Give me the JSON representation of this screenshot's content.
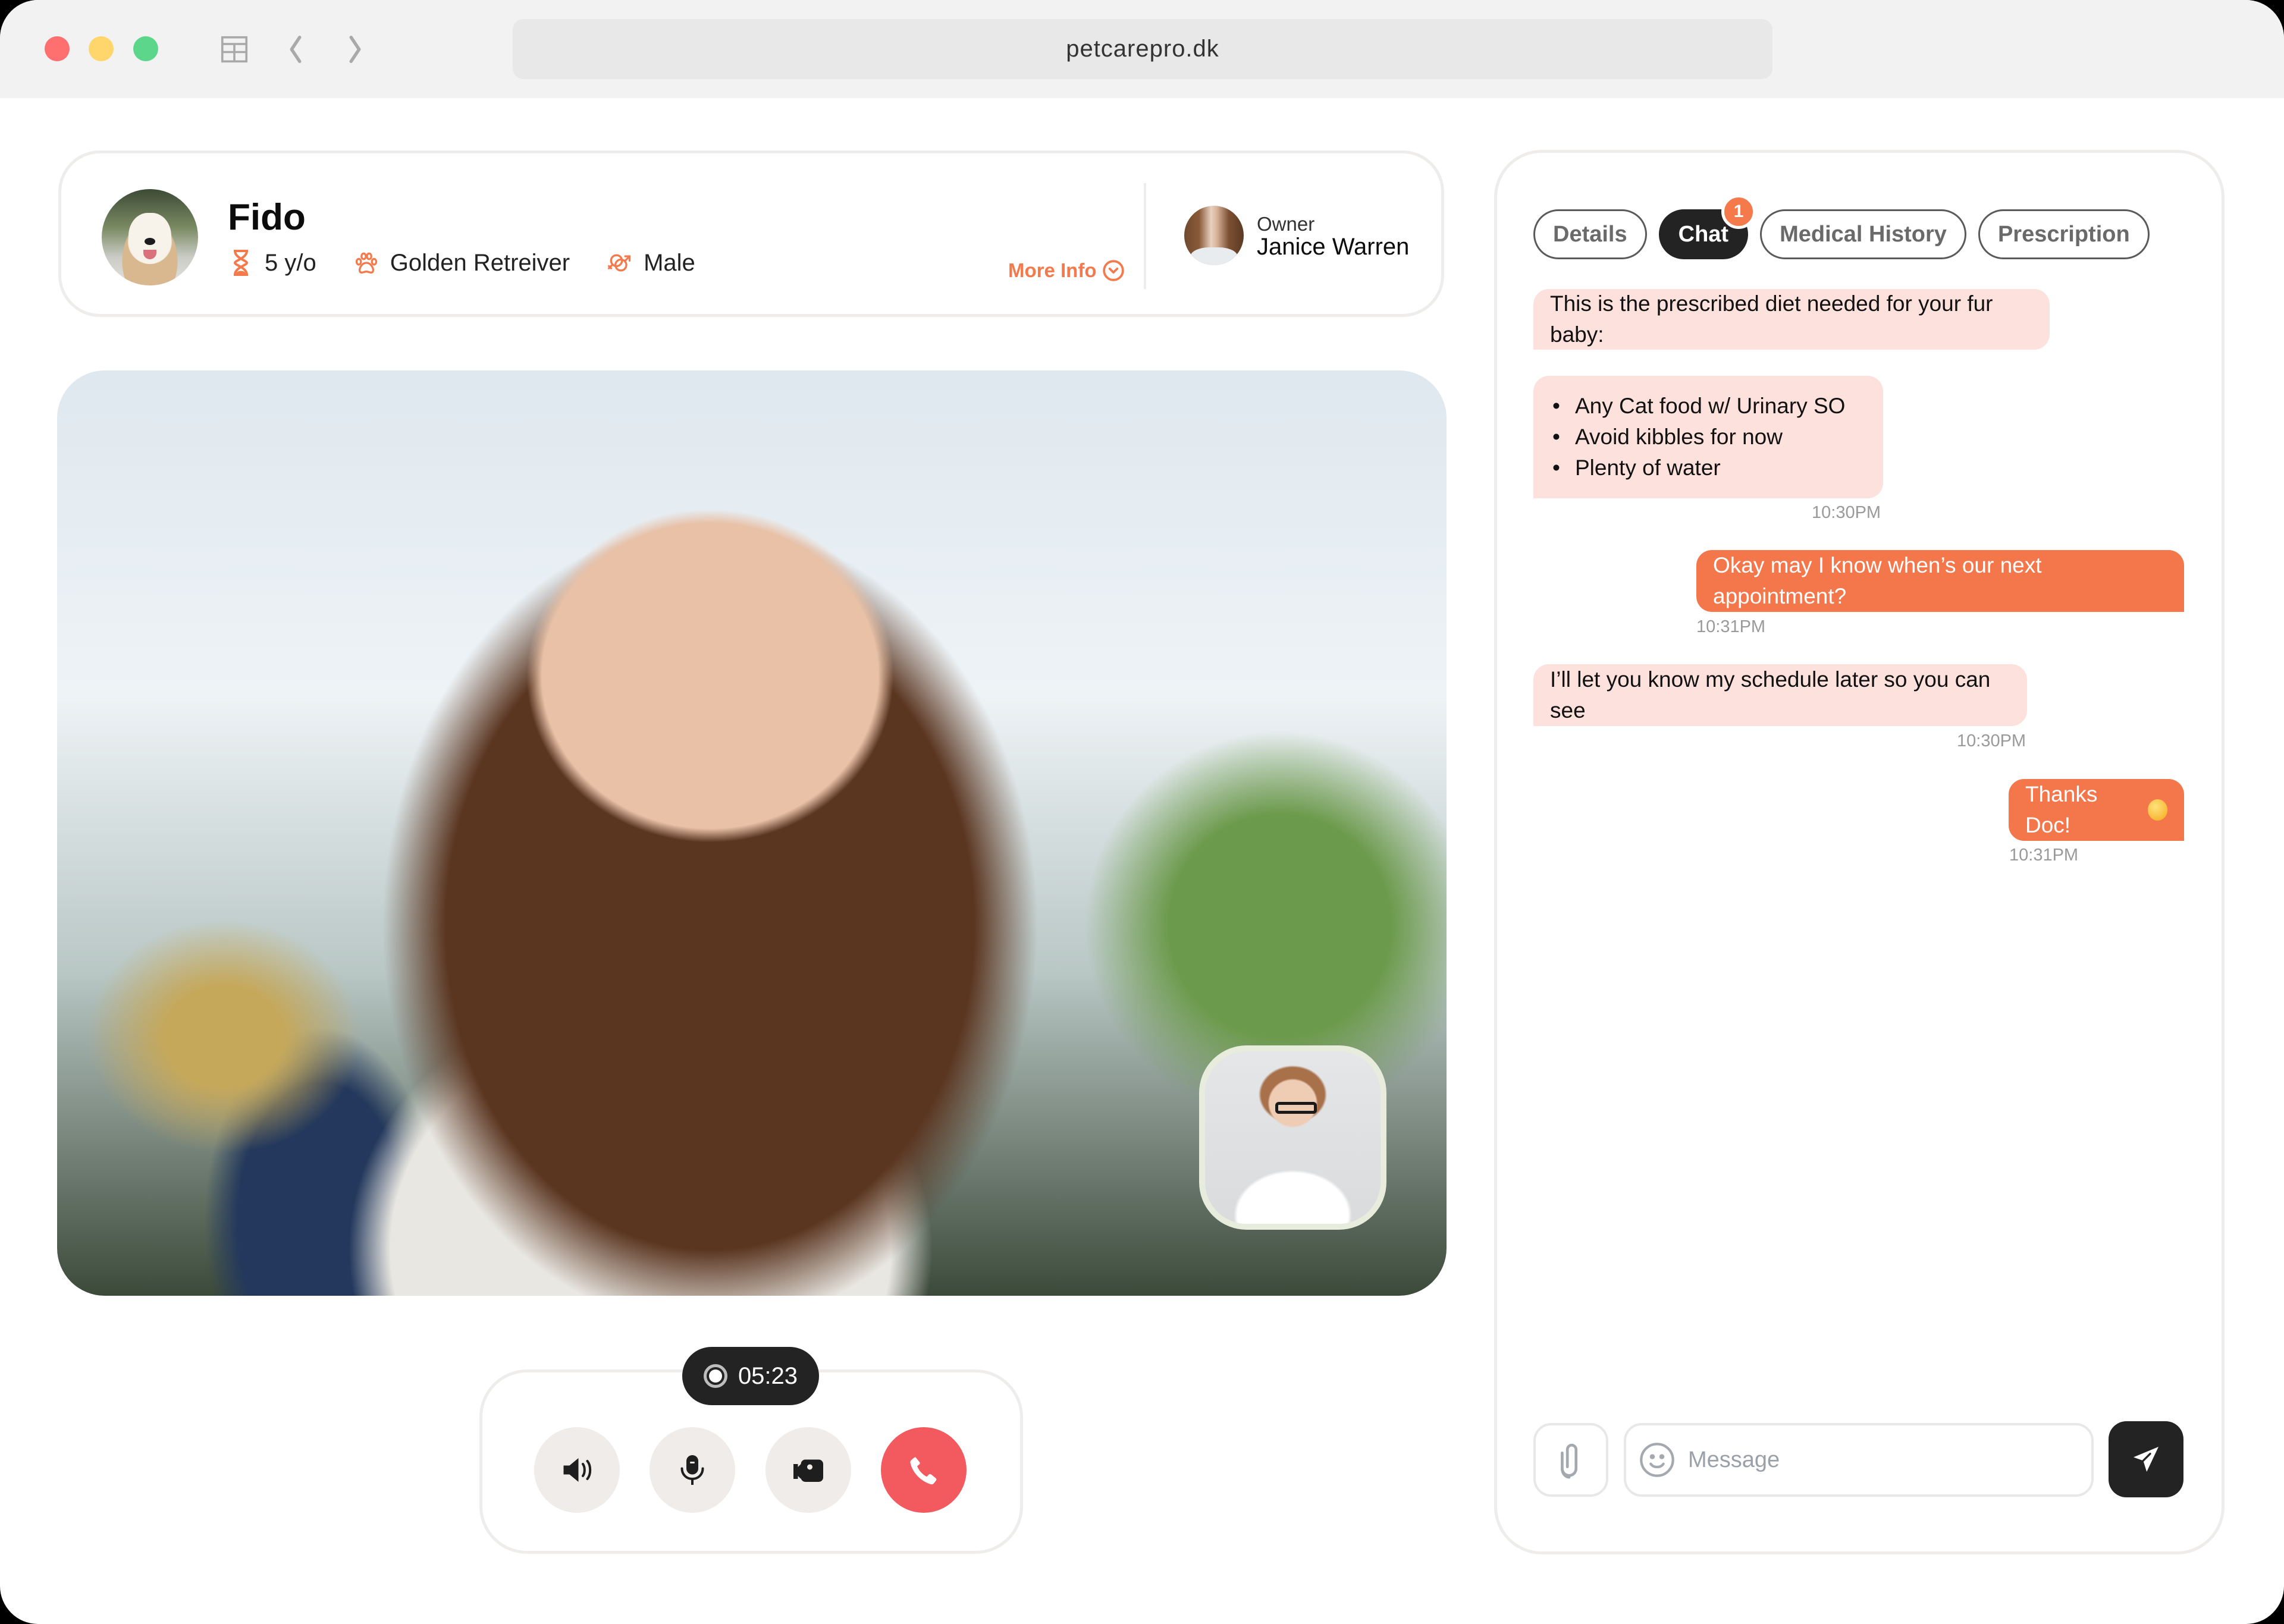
{
  "browser": {
    "url": "petcarepro.dk",
    "window_controls": [
      "close",
      "minimize",
      "maximize"
    ],
    "icons": [
      "sidebar-layout-icon",
      "back-icon",
      "forward-icon"
    ]
  },
  "pet": {
    "name": "Fido",
    "age": "5 y/o",
    "breed": "Golden Retreiver",
    "sex": "Male",
    "more_info_label": "More Info",
    "icons": {
      "age": "hourglass-icon",
      "breed": "paw-icon",
      "sex": "gender-icon",
      "more_info": "chevron-down-circle-icon"
    }
  },
  "owner": {
    "label": "Owner",
    "name": "Janice Warren"
  },
  "call": {
    "timer": "05:23",
    "controls": [
      {
        "name": "speaker",
        "icon": "speaker-icon"
      },
      {
        "name": "microphone",
        "icon": "microphone-icon"
      },
      {
        "name": "camera",
        "icon": "video-camera-icon"
      },
      {
        "name": "end-call",
        "icon": "phone-icon"
      }
    ]
  },
  "chat": {
    "tabs": [
      {
        "label": "Details",
        "active": false
      },
      {
        "label": "Chat",
        "active": true,
        "badge": "1"
      },
      {
        "label": "Medical History",
        "active": false
      },
      {
        "label": "Prescription",
        "active": false
      }
    ],
    "messages": [
      {
        "direction": "incoming",
        "text": "This is the prescribed diet needed for your fur baby:"
      },
      {
        "direction": "incoming",
        "list": [
          "Any Cat food w/ Urinary SO",
          "Avoid kibbles for now",
          "Plenty of water"
        ],
        "time": "10:30PM"
      },
      {
        "direction": "outgoing",
        "text": "Okay may I know when’s our next appointment?",
        "time": "10:31PM"
      },
      {
        "direction": "incoming",
        "text": "I’ll let you know my schedule later so you can see",
        "time": "10:30PM"
      },
      {
        "direction": "outgoing",
        "text": "Thanks Doc!",
        "emoji": "smiling-face",
        "time": "10:31PM"
      }
    ],
    "input": {
      "placeholder": "Message",
      "value": ""
    }
  },
  "colors": {
    "accent": "#f4774b",
    "incoming_bubble": "#fde1dc",
    "dark": "#232323",
    "end_call": "#f25a5f",
    "border": "#efedeb"
  }
}
